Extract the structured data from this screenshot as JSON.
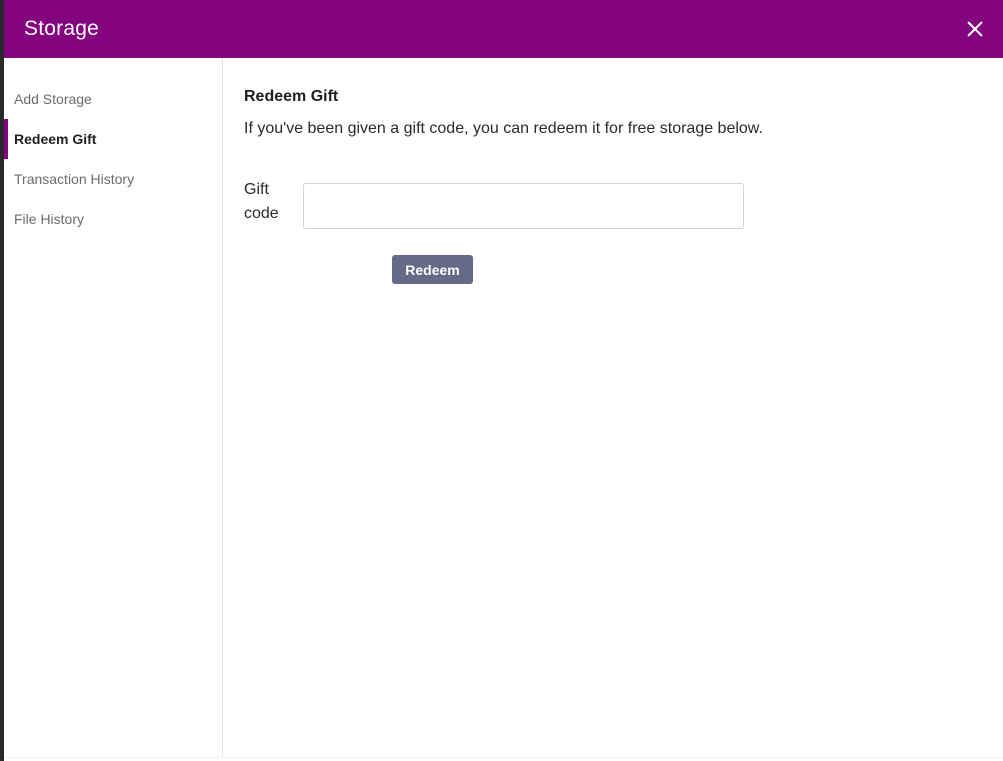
{
  "colors": {
    "header_bg": "#84047f",
    "accent": "#84047f",
    "button_bg": "#676a86",
    "button_text": "#ffffff",
    "nav_text": "#6b6b6b",
    "nav_active_text": "#1f1f1f"
  },
  "modal": {
    "title": "Storage",
    "close_icon": "close-icon"
  },
  "sidebar": {
    "items": [
      {
        "label": "Add Storage",
        "active": false
      },
      {
        "label": "Redeem Gift",
        "active": true
      },
      {
        "label": "Transaction History",
        "active": false
      },
      {
        "label": "File History",
        "active": false
      }
    ]
  },
  "main": {
    "section_title": "Redeem Gift",
    "description": "If you've been given a gift code, you can redeem it for free storage below.",
    "gift_code_label_line1": "Gift",
    "gift_code_label_line2": "code",
    "gift_code_value": "",
    "gift_code_placeholder": "",
    "redeem_button_label": "Redeem"
  }
}
